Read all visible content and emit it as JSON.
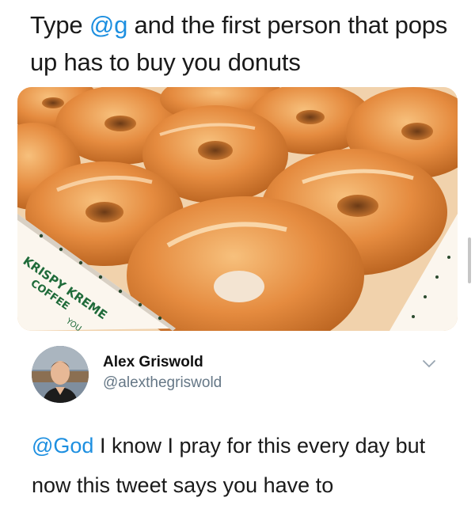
{
  "tweet": {
    "text_prefix": "Type ",
    "mention": "@g",
    "text_suffix": " and the first person that pops up has to buy you donuts"
  },
  "media": {
    "box_brand_line1": "KRISPY KREME",
    "box_brand_line2": "COFFEE",
    "box_text": "YOU"
  },
  "reply": {
    "display_name": "Alex Griswold",
    "handle": "@alexthegriswold",
    "mention": "@God",
    "text": " I know I pray for this every day but now this tweet says you have to"
  },
  "colors": {
    "mention": "#1d8fe0",
    "handle": "#657786",
    "glaze": "#e58b3f"
  }
}
